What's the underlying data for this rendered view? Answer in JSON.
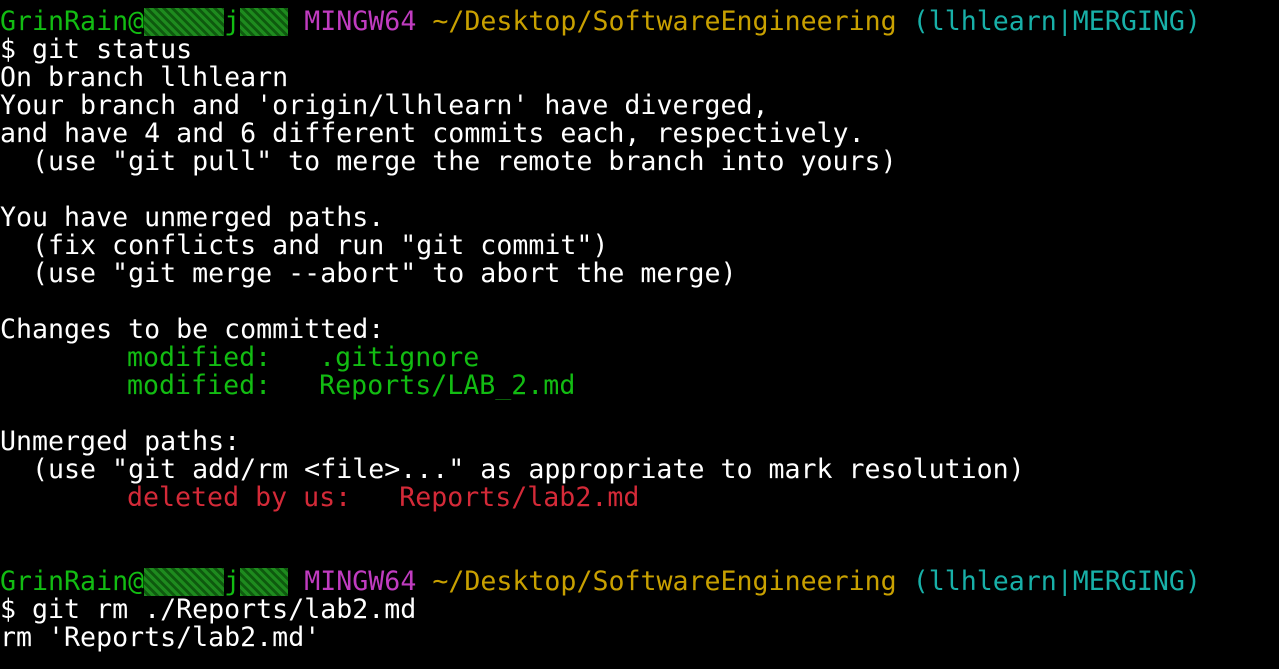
{
  "colors": {
    "background": "#000000",
    "text": "#ffffff",
    "user": "#12bc12",
    "system": "#c03cc0",
    "path": "#c8a000",
    "branch": "#18b0a8",
    "staged": "#12bc12",
    "unmerged": "#d42a38"
  },
  "prompt1": {
    "user": "GrinRain@",
    "host_blur_a": "▒▒▒▒▒",
    "host_visible": "j",
    "host_blur_b": "▒▒▒",
    "system": "MINGW64",
    "path": "~/Desktop/SoftwareEngineering",
    "branch": "(llhlearn|MERGING)"
  },
  "command1": "$ git status",
  "status": {
    "on_branch": "On branch llhlearn",
    "diverged_1": "Your branch and 'origin/llhlearn' have diverged,",
    "diverged_2": "and have 4 and 6 different commits each, respectively.",
    "hint_pull": "(use \"git pull\" to merge the remote branch into yours)",
    "unmerged_header": "You have unmerged paths.",
    "hint_fix": "(fix conflicts and run \"git commit\")",
    "hint_abort": "(use \"git merge --abort\" to abort the merge)",
    "staged_header": "Changes to be committed:",
    "staged_files": [
      {
        "status": "modified:",
        "file": ".gitignore"
      },
      {
        "status": "modified:",
        "file": "Reports/LAB_2.md"
      }
    ],
    "unmerged_paths_header": "Unmerged paths:",
    "hint_add": "(use \"git add/rm <file>...\" as appropriate to mark resolution)",
    "unmerged_files": [
      {
        "status": "deleted by us:",
        "file": "Reports/lab2.md"
      }
    ]
  },
  "prompt2": {
    "user": "GrinRain@",
    "host_blur_a": "▒▒▒▒▒",
    "host_visible": "j",
    "host_blur_b": "▒▒▒",
    "system": "MINGW64",
    "path": "~/Desktop/SoftwareEngineering",
    "branch": "(llhlearn|MERGING)"
  },
  "command2": "$ git rm ./Reports/lab2.md",
  "output2": "rm 'Reports/lab2.md'"
}
